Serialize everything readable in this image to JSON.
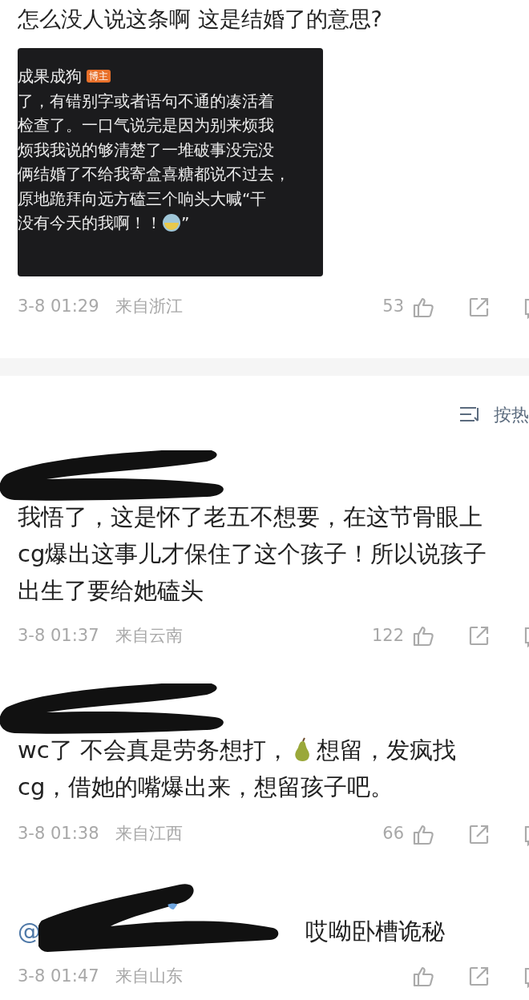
{
  "post": {
    "question": "怎么没人说这条啊 这是结婚了的意思?",
    "embedded_screenshot": {
      "username": "成果成狗",
      "badge": "博主",
      "lines": [
        [
          {
            "kind": "text",
            "text": "了，有错别字或者语句不通的凑活着"
          }
        ],
        [
          {
            "kind": "text",
            "text": "检查了。一口气说完是因为别来烦我"
          }
        ],
        [
          {
            "kind": "text",
            "text": "烦我我说的够清楚了一堆破事没完没"
          }
        ],
        [
          {
            "kind": "text",
            "text": "俩结婚了不给我寄盒喜糖都说不过去，"
          }
        ],
        [
          {
            "kind": "text",
            "text": "原地跪拜向远方磕三个响头大喊“干"
          }
        ],
        [
          {
            "kind": "text",
            "text": "没有今天的我啊！！"
          },
          {
            "kind": "emoji"
          },
          {
            "kind": "text",
            "text": "”"
          }
        ]
      ]
    },
    "meta": {
      "time": "3-8 01:29",
      "location": "来自浙江",
      "likes": "53"
    }
  },
  "sort": {
    "label": "按热"
  },
  "comments": [
    {
      "lines": [
        [
          {
            "kind": "text",
            "text": "我悟了，这是怀了老五不想要，在这节骨眼上"
          }
        ],
        [
          {
            "kind": "text",
            "text": "cg爆出这事儿才保住了这个孩子！所以说孩子"
          }
        ],
        [
          {
            "kind": "text",
            "text": "出生了要给她磕头"
          }
        ]
      ],
      "meta": {
        "time": "3-8 01:37",
        "location": "来自云南",
        "likes": "122"
      }
    },
    {
      "lines": [
        [
          {
            "kind": "text",
            "text": "wc了 不会真是劳务想打，"
          },
          {
            "kind": "pear"
          },
          {
            "kind": "text",
            "text": "想留，发疯找"
          }
        ],
        [
          {
            "kind": "text",
            "text": "cg，借她的嘴爆出来，想留孩子吧。"
          }
        ]
      ],
      "meta": {
        "time": "3-8 01:38",
        "location": "来自江西",
        "likes": "66"
      }
    },
    {
      "lines": [
        [
          {
            "kind": "mention",
            "text": "@"
          },
          {
            "kind": "text",
            "text": "哎呦卧槽诡秘"
          }
        ]
      ],
      "meta": {
        "time": "3-8 01:47",
        "location": "来自山东"
      }
    }
  ]
}
